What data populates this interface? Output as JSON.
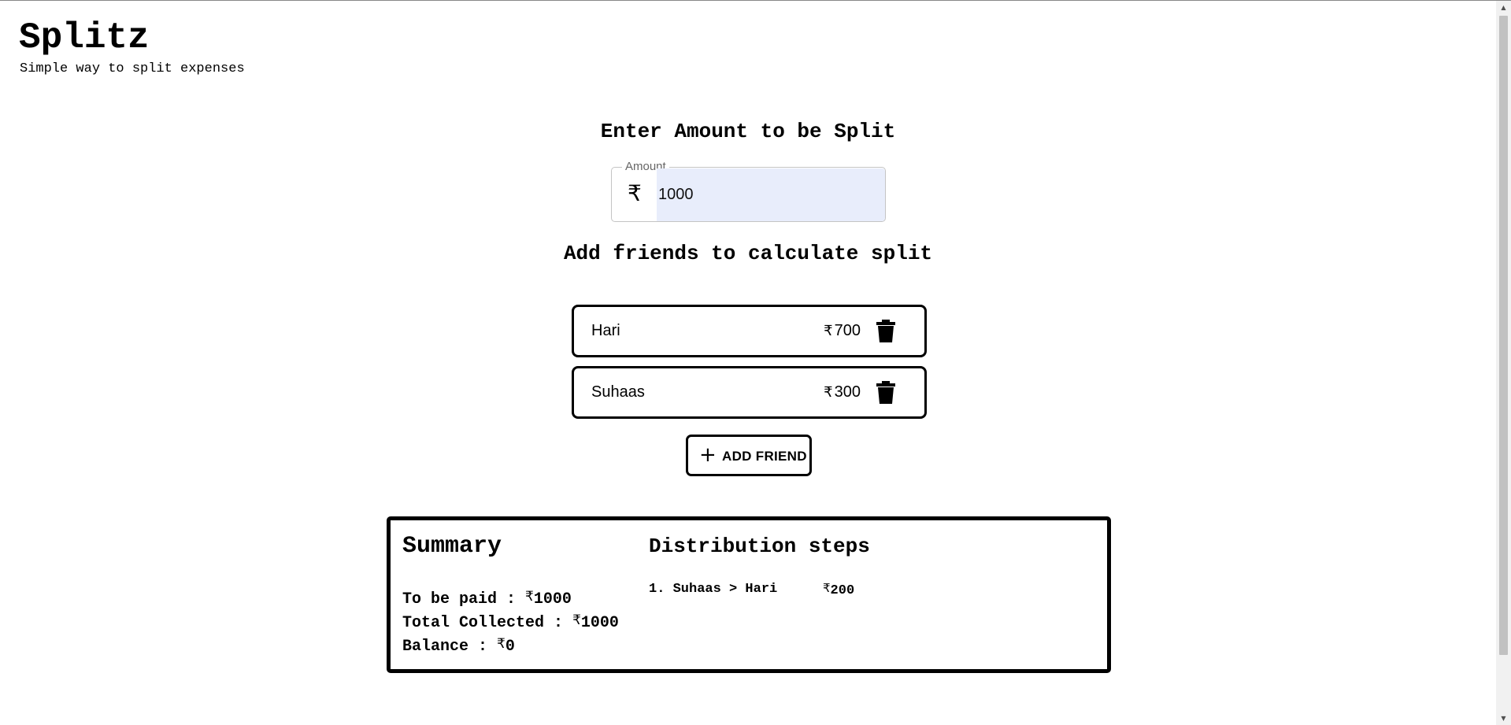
{
  "header": {
    "title": "Splitz",
    "subtitle": "Simple way to split expenses"
  },
  "amount_section": {
    "heading": "Enter Amount to be Split",
    "field_label": "Amount",
    "currency_symbol": "₹",
    "value": "1000"
  },
  "friends_section": {
    "heading": "Add friends to calculate split",
    "friends": [
      {
        "name": "Hari",
        "amount": "700"
      },
      {
        "name": "Suhaas",
        "amount": "300"
      }
    ],
    "add_button_label": "ADD FRIEND"
  },
  "summary": {
    "title": "Summary",
    "to_be_paid_label": "To be paid :",
    "to_be_paid_value": "1000",
    "total_collected_label": "Total Collected :",
    "total_collected_value": "1000",
    "balance_label": "Balance :",
    "balance_value": "0"
  },
  "distribution": {
    "title": "Distribution steps",
    "steps": [
      {
        "text": "1. Suhaas > Hari",
        "amount": "200"
      }
    ]
  },
  "icons": {
    "rupee": "rupee-icon",
    "delete": "trash-icon",
    "add": "plus-icon"
  }
}
